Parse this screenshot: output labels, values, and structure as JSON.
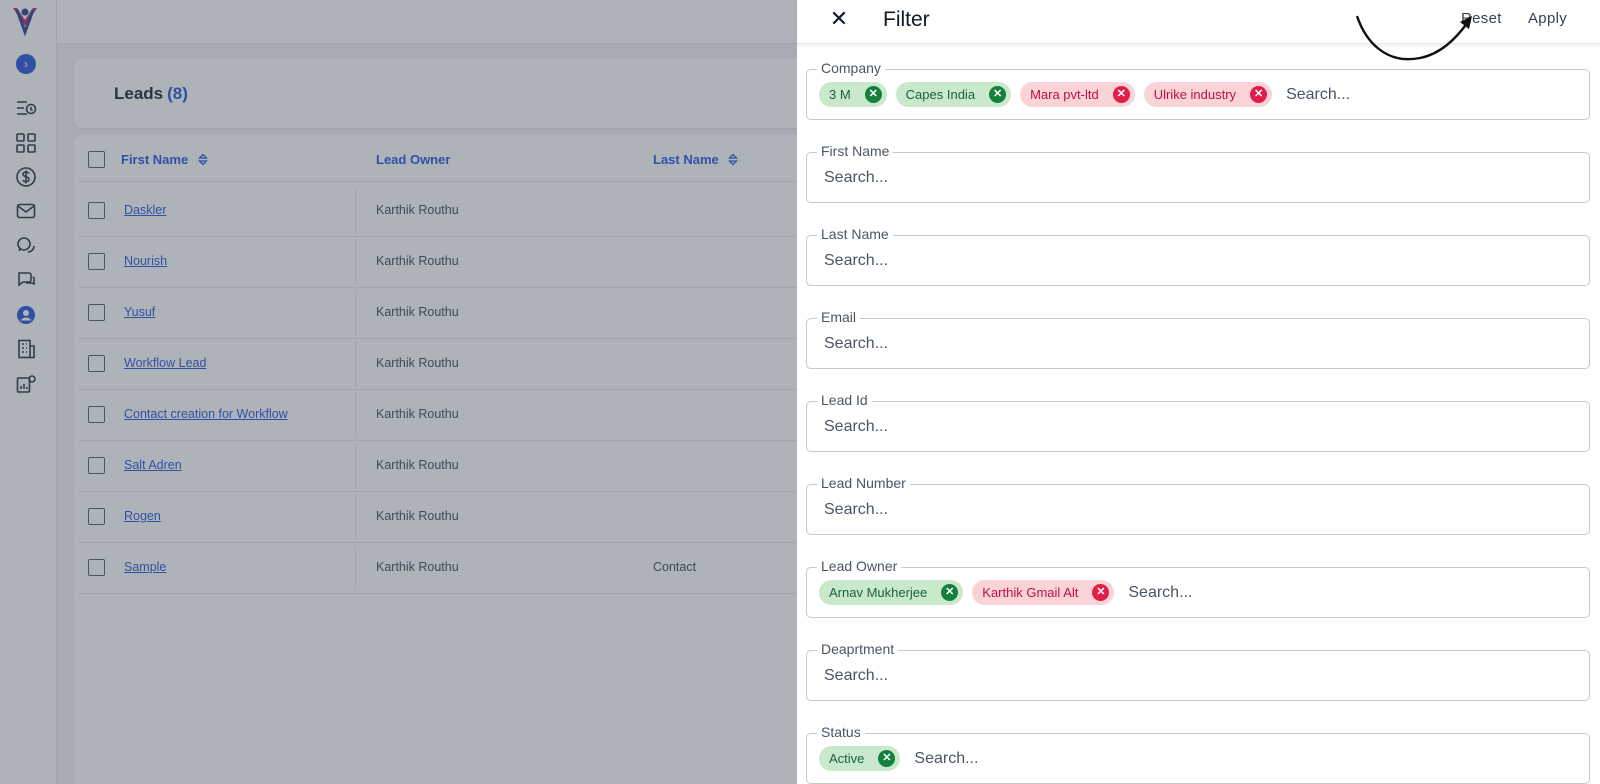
{
  "colors": {
    "accent": "#1d4ed8",
    "chip_green_bg": "#c9e8cc",
    "chip_green_text": "#166534",
    "chip_red_bg": "#f9d3d8",
    "chip_red_text": "#be123c"
  },
  "sidebar": {
    "icons": [
      "list-clock-icon",
      "grid-icon",
      "dollar-icon",
      "mail-icon",
      "chat-bubbles-icon",
      "conversation-icon",
      "user-icon",
      "building-icon",
      "settings-chart-icon"
    ],
    "active": "user-icon"
  },
  "leads": {
    "title": "Leads",
    "count": "(8)",
    "columns": [
      "First Name",
      "Lead Owner",
      "Last Name"
    ],
    "rows": [
      {
        "first_name": "Daskler",
        "owner": "Karthik Routhu",
        "last_name": ""
      },
      {
        "first_name": "Nourish",
        "owner": "Karthik Routhu",
        "last_name": ""
      },
      {
        "first_name": "Yusuf",
        "owner": "Karthik Routhu",
        "last_name": ""
      },
      {
        "first_name": "Workflow Lead",
        "owner": "Karthik Routhu",
        "last_name": ""
      },
      {
        "first_name": "Contact creation for Workflow",
        "owner": "Karthik Routhu",
        "last_name": ""
      },
      {
        "first_name": "Salt Adren",
        "owner": "Karthik Routhu",
        "last_name": ""
      },
      {
        "first_name": "Rogen",
        "owner": "Karthik Routhu",
        "last_name": ""
      },
      {
        "first_name": "Sample",
        "owner": "Karthik Routhu",
        "last_name": "Contact"
      }
    ]
  },
  "filter": {
    "title": "Filter",
    "close_icon": "close-icon",
    "reset_label": "Reset",
    "apply_label": "Apply",
    "placeholder": "Search...",
    "fields": [
      {
        "label": "Company",
        "chips": [
          {
            "text": "3 M",
            "tone": "green"
          },
          {
            "text": "Capes India",
            "tone": "green"
          },
          {
            "text": "Mara pvt-ltd",
            "tone": "red"
          },
          {
            "text": "Ulrike industry",
            "tone": "red"
          }
        ]
      },
      {
        "label": "First Name",
        "chips": []
      },
      {
        "label": "Last Name",
        "chips": []
      },
      {
        "label": "Email",
        "chips": []
      },
      {
        "label": "Lead Id",
        "chips": []
      },
      {
        "label": "Lead Number",
        "chips": []
      },
      {
        "label": "Lead Owner",
        "chips": [
          {
            "text": "Arnav Mukherjee",
            "tone": "green"
          },
          {
            "text": "Karthik Gmail Alt",
            "tone": "red"
          }
        ]
      },
      {
        "label": "Deaprtment",
        "chips": []
      },
      {
        "label": "Status",
        "chips": [
          {
            "text": "Active",
            "tone": "green"
          }
        ]
      }
    ]
  }
}
